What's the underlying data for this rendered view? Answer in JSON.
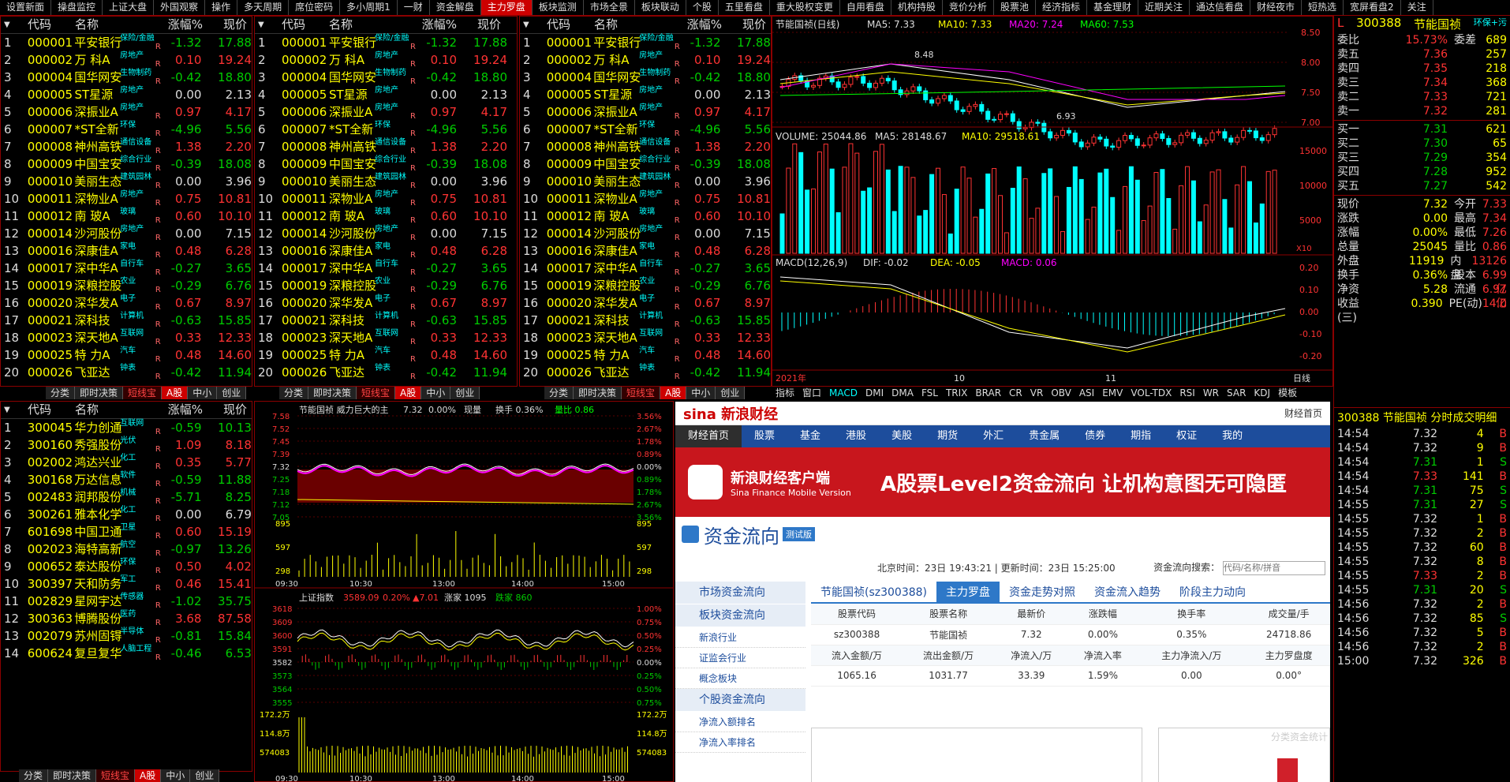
{
  "top_tabs": [
    "设置新面",
    "操盘监控",
    "上证大盘",
    "外国观察",
    "操作",
    "多天周期",
    "席位密码",
    "多小周期1",
    "一财",
    "资金解盘",
    "主力罗盘",
    "板块监测",
    "市场全景",
    "板块联动",
    "个股",
    "五里看盘",
    "重大股权变更",
    "自用看盘",
    "机构持股",
    "竞价分析",
    "股票池",
    "经济指标",
    "基金理财",
    "近期关注",
    "通达信看盘",
    "财经夜市",
    "短热选",
    "宽屏看盘2",
    "关注"
  ],
  "active_tab": "主力罗盘",
  "list_header": {
    "code": "代码",
    "name": "名称",
    "pct": "涨幅%",
    "price": "现价"
  },
  "stocks": [
    {
      "i": "1",
      "code": "000001",
      "name": "平安银行",
      "tag": "保险/金融",
      "flag": "R",
      "pct": "-1.32",
      "price": "17.88",
      "dir": "dn"
    },
    {
      "i": "2",
      "code": "000002",
      "name": "万 科A",
      "tag": "房地产",
      "flag": "R",
      "pct": "0.10",
      "price": "19.24",
      "dir": "up"
    },
    {
      "i": "3",
      "code": "000004",
      "name": "国华网安",
      "tag": "生物制药",
      "flag": "R",
      "pct": "-0.42",
      "price": "18.80",
      "dir": "dn"
    },
    {
      "i": "4",
      "code": "000005",
      "name": "ST星源",
      "tag": "房地产",
      "flag": "",
      "pct": "0.00",
      "price": "2.13",
      "dir": "fl"
    },
    {
      "i": "5",
      "code": "000006",
      "name": "深振业A",
      "tag": "房地产",
      "flag": "R",
      "pct": "0.97",
      "price": "4.17",
      "dir": "up"
    },
    {
      "i": "6",
      "code": "000007",
      "name": "*ST全新",
      "tag": "环保",
      "flag": "R",
      "pct": "-4.96",
      "price": "5.56",
      "dir": "dn"
    },
    {
      "i": "7",
      "code": "000008",
      "name": "神州高铁",
      "tag": "通信设备",
      "flag": "R",
      "pct": "1.38",
      "price": "2.20",
      "dir": "up"
    },
    {
      "i": "8",
      "code": "000009",
      "name": "中国宝安",
      "tag": "综合行业",
      "flag": "R",
      "pct": "-0.39",
      "price": "18.08",
      "dir": "dn"
    },
    {
      "i": "9",
      "code": "000010",
      "name": "美丽生态",
      "tag": "建筑园林",
      "flag": "R",
      "pct": "0.00",
      "price": "3.96",
      "dir": "fl"
    },
    {
      "i": "10",
      "code": "000011",
      "name": "深物业A",
      "tag": "房地产",
      "flag": "R",
      "pct": "0.75",
      "price": "10.81",
      "dir": "up"
    },
    {
      "i": "11",
      "code": "000012",
      "name": "南 玻A",
      "tag": "玻璃",
      "flag": "R",
      "pct": "0.60",
      "price": "10.10",
      "dir": "up"
    },
    {
      "i": "12",
      "code": "000014",
      "name": "沙河股份",
      "tag": "房地产",
      "flag": "R",
      "pct": "0.00",
      "price": "7.15",
      "dir": "fl"
    },
    {
      "i": "13",
      "code": "000016",
      "name": "深康佳A",
      "tag": "家电",
      "flag": "R",
      "pct": "0.48",
      "price": "6.28",
      "dir": "up"
    },
    {
      "i": "14",
      "code": "000017",
      "name": "深中华A",
      "tag": "自行车",
      "flag": "R",
      "pct": "-0.27",
      "price": "3.65",
      "dir": "dn"
    },
    {
      "i": "15",
      "code": "000019",
      "name": "深粮控股",
      "tag": "农业",
      "flag": "R",
      "pct": "-0.29",
      "price": "6.76",
      "dir": "dn"
    },
    {
      "i": "16",
      "code": "000020",
      "name": "深华发A",
      "tag": "电子",
      "flag": "R",
      "pct": "0.67",
      "price": "8.97",
      "dir": "up"
    },
    {
      "i": "17",
      "code": "000021",
      "name": "深科技",
      "tag": "计算机",
      "flag": "R",
      "pct": "-0.63",
      "price": "15.85",
      "dir": "dn"
    },
    {
      "i": "18",
      "code": "000023",
      "name": "深天地A",
      "tag": "互联网",
      "flag": "R",
      "pct": "0.33",
      "price": "12.33",
      "dir": "up"
    },
    {
      "i": "19",
      "code": "000025",
      "name": "特 力A",
      "tag": "汽车",
      "flag": "R",
      "pct": "0.48",
      "price": "14.60",
      "dir": "up"
    },
    {
      "i": "20",
      "code": "000026",
      "name": "飞亚达",
      "tag": "钟表",
      "flag": "R",
      "pct": "-0.42",
      "price": "11.94",
      "dir": "dn"
    }
  ],
  "stocks2": [
    {
      "i": "1",
      "code": "300045",
      "name": "华力创通",
      "tag": "互联网",
      "flag": "R",
      "pct": "-0.59",
      "price": "10.13",
      "dir": "dn"
    },
    {
      "i": "2",
      "code": "300160",
      "name": "秀强股份",
      "tag": "光伏",
      "flag": "R",
      "pct": "1.09",
      "price": "8.18",
      "dir": "up"
    },
    {
      "i": "3",
      "code": "002002",
      "name": "鸿达兴业",
      "tag": "化工",
      "flag": "R",
      "pct": "0.35",
      "price": "5.77",
      "dir": "up"
    },
    {
      "i": "4",
      "code": "300168",
      "name": "万达信息",
      "tag": "软件",
      "flag": "R",
      "pct": "-0.59",
      "price": "11.88",
      "dir": "dn"
    },
    {
      "i": "5",
      "code": "002483",
      "name": "润邦股份",
      "tag": "机械",
      "flag": "R",
      "pct": "-5.71",
      "price": "8.25",
      "dir": "dn"
    },
    {
      "i": "6",
      "code": "300261",
      "name": "雅本化学",
      "tag": "化工",
      "flag": "R",
      "pct": "0.00",
      "price": "6.79",
      "dir": "fl"
    },
    {
      "i": "7",
      "code": "601698",
      "name": "中国卫通",
      "tag": "卫星",
      "flag": "R",
      "pct": "0.60",
      "price": "15.19",
      "dir": "up"
    },
    {
      "i": "8",
      "code": "002023",
      "name": "海特高新",
      "tag": "航空",
      "flag": "R",
      "pct": "-0.97",
      "price": "13.26",
      "dir": "dn"
    },
    {
      "i": "9",
      "code": "000652",
      "name": "泰达股份",
      "tag": "环保",
      "flag": "R",
      "pct": "0.50",
      "price": "4.02",
      "dir": "up"
    },
    {
      "i": "10",
      "code": "300397",
      "name": "天和防务",
      "tag": "军工",
      "flag": "R",
      "pct": "0.46",
      "price": "15.41",
      "dir": "up"
    },
    {
      "i": "11",
      "code": "002829",
      "name": "星网宇达",
      "tag": "传感器",
      "flag": "R",
      "pct": "-1.02",
      "price": "35.75",
      "dir": "dn"
    },
    {
      "i": "12",
      "code": "300363",
      "name": "博腾股份",
      "tag": "医药",
      "flag": "R",
      "pct": "3.68",
      "price": "87.58",
      "dir": "up"
    },
    {
      "i": "13",
      "code": "002079",
      "name": "苏州固锝",
      "tag": "半导体",
      "flag": "R",
      "pct": "-0.81",
      "price": "15.84",
      "dir": "dn"
    },
    {
      "i": "14",
      "code": "600624",
      "name": "复旦复华",
      "tag": "人脑工程",
      "flag": "R",
      "pct": "-0.46",
      "price": "6.53",
      "dir": "dn"
    }
  ],
  "bottom_tabs": [
    "分类",
    "即时决策",
    "短线宝",
    "A股",
    "中小",
    "创业"
  ],
  "kline": {
    "title": "节能国祯(日线)",
    "ma5": "MA5: 7.33",
    "ma10": "MA10: 7.33",
    "ma20": "MA20: 7.24",
    "ma60": "MA60: 7.53",
    "high": "8.48",
    "low": "6.93",
    "yticks": [
      "8.50",
      "8.00",
      "7.50",
      "7.00"
    ]
  },
  "volume": {
    "title": "VOLUME: 25044.86",
    "ma5": "MA5: 28148.67",
    "ma10": "MA10: 29518.61",
    "yticks": [
      "15000",
      "10000",
      "5000"
    ],
    "unit": "X10"
  },
  "macd": {
    "title": "MACD(12,26,9)",
    "dif": "DIF: -0.02",
    "dea": "DEA: -0.05",
    "macd": "MACD: 0.06",
    "yticks": [
      "0.20",
      "0.10",
      "0.00",
      "-0.10",
      "-0.20"
    ]
  },
  "kline_dates": [
    "2021年",
    "10",
    "11",
    "日线"
  ],
  "indicator_tabs": [
    "指标",
    "窗口",
    "MACD",
    "DMI",
    "DMA",
    "FSL",
    "TRIX",
    "BRAR",
    "CR",
    "VR",
    "OBV",
    "ASI",
    "EMV",
    "VOL-TDX",
    "RSI",
    "WR",
    "SAR",
    "KDJ",
    "模板"
  ],
  "intraday": {
    "title": "节能国祯 威力巨大的主",
    "price": "7.32",
    "pct": "0.00%",
    "vol": "现量",
    "chg": "换手 0.36%",
    "ratio": "量比 0.86",
    "yl": [
      "7.58",
      "7.52",
      "7.45",
      "7.39",
      "7.32",
      "7.25",
      "7.18",
      "7.12",
      "7.05"
    ],
    "yr": [
      "3.56%",
      "2.67%",
      "1.78%",
      "0.89%",
      "0.00%",
      "0.89%",
      "1.78%",
      "2.67%",
      "3.56%"
    ],
    "vl": [
      "895",
      "597",
      "298"
    ],
    "times": [
      "09:30",
      "10:30",
      "13:00",
      "14:00",
      "15:00"
    ]
  },
  "index": {
    "title": "上证指数",
    "value": "3589.09",
    "pct": "0.20%",
    "chg": "▲7.01",
    "up": "涨家 1095",
    "down": "跌家 860",
    "yl": [
      "3618",
      "3609",
      "3600",
      "3591",
      "3582",
      "3573",
      "3564",
      "3555"
    ],
    "yr": [
      "1.00%",
      "0.75%",
      "0.50%",
      "0.25%",
      "0.00%",
      "0.25%",
      "0.50%",
      "0.75%"
    ],
    "vl": [
      "172.2万",
      "114.8万",
      "574083"
    ],
    "times": [
      "09:30",
      "10:30",
      "13:00",
      "14:00",
      "15:00"
    ]
  },
  "sina": {
    "logo": "sina 新浪财经",
    "home": "财经首页",
    "nav": [
      "财经首页",
      "股票",
      "基金",
      "港股",
      "美股",
      "期货",
      "外汇",
      "贵金属",
      "债券",
      "期指",
      "权证",
      "我的"
    ],
    "banner_a": "新浪财经客户端",
    "banner_b": "Sina Finance Mobile Version",
    "banner_c": "A股票Level2资金流向 让机构意图无可隐匿",
    "section": "资金流向",
    "beta": "测试版",
    "time": "北京时间：23日 19:43:21 | 更新时间：23日 15:25:00",
    "search_label": "资金流向搜索：",
    "search_ph": "代码/名称/拼音",
    "left": [
      "市场资金流向",
      "板块资金流向",
      "新浪行业",
      "证监会行业",
      "概念板块",
      "个股资金流向",
      "净流入额排名",
      "净流入率排名"
    ],
    "mtabs": [
      "节能国祯(sz300388)",
      "主力罗盘",
      "资金走势对照",
      "资金流入趋势",
      "阶段主力动向"
    ],
    "t1h": [
      "股票代码",
      "股票名称",
      "最新价",
      "涨跌幅",
      "换手率",
      "成交量/手"
    ],
    "t1v": [
      "sz300388",
      "节能国祯",
      "7.32",
      "0.00%",
      "0.35%",
      "24718.86"
    ],
    "t2h": [
      "流入金额/万",
      "流出金额/万",
      "净流入/万",
      "净流入率",
      "主力净流入/万",
      "主力罗盘度"
    ],
    "t2v": [
      "1065.16",
      "1031.77",
      "33.39",
      "1.59%",
      "0.00",
      "0.00°"
    ],
    "side": "分类资金统计"
  },
  "quote": {
    "l": "L",
    "code": "300388",
    "name": "节能国祯",
    "tag": "环保+污",
    "wb": "委比",
    "wb_v": "15.73%",
    "wc": "委差",
    "wc_v": "689",
    "sell": [
      [
        "卖五",
        "7.36",
        "257"
      ],
      [
        "卖四",
        "7.35",
        "218"
      ],
      [
        "卖三",
        "7.34",
        "368"
      ],
      [
        "卖二",
        "7.33",
        "721"
      ],
      [
        "卖一",
        "7.32",
        "281"
      ]
    ],
    "buy": [
      [
        "买一",
        "7.31",
        "621"
      ],
      [
        "买二",
        "7.30",
        "65"
      ],
      [
        "买三",
        "7.29",
        "354"
      ],
      [
        "买四",
        "7.28",
        "952"
      ],
      [
        "买五",
        "7.27",
        "542"
      ]
    ],
    "stats": [
      [
        "现价",
        "7.32",
        "今开",
        "7.33"
      ],
      [
        "涨跌",
        "0.00",
        "最高",
        "7.34"
      ],
      [
        "涨幅",
        "0.00%",
        "最低",
        "7.26"
      ],
      [
        "总量",
        "25045",
        "量比",
        "0.86"
      ],
      [
        "外盘",
        "11919",
        "内盘",
        "13126"
      ],
      [
        "换手",
        "0.36%",
        "股本",
        "6.99亿"
      ],
      [
        "净资",
        "5.28",
        "流通",
        "6.97亿"
      ],
      [
        "收益(三)",
        "0.390",
        "PE(动)",
        "14.0"
      ]
    ],
    "ticks_title": "300388 节能国祯 分时成交明细",
    "ticks": [
      [
        "14:54",
        "7.32",
        "4",
        "B"
      ],
      [
        "14:54",
        "7.32",
        "9",
        "B"
      ],
      [
        "14:54",
        "7.31",
        "1",
        "S"
      ],
      [
        "14:54",
        "7.33",
        "141",
        "B"
      ],
      [
        "14:54",
        "7.31",
        "75",
        "S"
      ],
      [
        "14:55",
        "7.31",
        "27",
        "S"
      ],
      [
        "14:55",
        "7.32",
        "1",
        "B"
      ],
      [
        "14:55",
        "7.32",
        "2",
        "B"
      ],
      [
        "14:55",
        "7.32",
        "60",
        "B"
      ],
      [
        "14:55",
        "7.32",
        "8",
        "B"
      ],
      [
        "14:55",
        "7.33",
        "2",
        "B"
      ],
      [
        "14:55",
        "7.31",
        "20",
        "S"
      ],
      [
        "14:56",
        "7.32",
        "2",
        "B"
      ],
      [
        "14:56",
        "7.32",
        "85",
        "S"
      ],
      [
        "14:56",
        "7.32",
        "5",
        "B"
      ],
      [
        "14:56",
        "7.32",
        "2",
        "B"
      ],
      [
        "15:00",
        "7.32",
        "326",
        "B"
      ]
    ]
  },
  "colors": {
    "up": "#ff3333",
    "down": "#00cc00",
    "accent": "#cc0000",
    "sina_blue": "#1d4d9c"
  }
}
